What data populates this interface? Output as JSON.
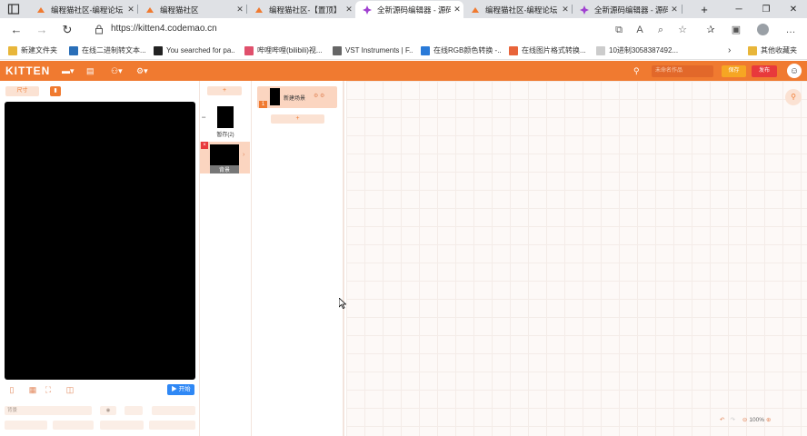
{
  "browser": {
    "tabs": [
      {
        "title": "编程猫社区-编程论坛",
        "favicon_color": "#f07a30",
        "active": false
      },
      {
        "title": "编程猫社区",
        "favicon_color": "#f07a30",
        "active": false
      },
      {
        "title": "编程猫社区-【置顶】",
        "favicon_color": "#f07a30",
        "active": false
      },
      {
        "title": "全新源码编辑器 - 源码",
        "favicon_color": "#a040d0",
        "active": true
      },
      {
        "title": "编程猫社区-编程论坛",
        "favicon_color": "#f07a30",
        "active": false
      },
      {
        "title": "全新源码编辑器 - 源码",
        "favicon_color": "#a040d0",
        "active": false
      }
    ],
    "url": "https://kitten4.codemao.cn",
    "bookmarks": [
      {
        "label": "新建文件夹",
        "icon_color": "#e8b63a"
      },
      {
        "label": "在线二进制转文本...",
        "icon_color": "#2a6fb8"
      },
      {
        "label": "You searched for pa...",
        "icon_color": "#222222"
      },
      {
        "label": "哔哩哔哩(bilibili)视...",
        "icon_color": "#e0506c"
      },
      {
        "label": "VST Instruments | F...",
        "icon_color": "#666666"
      },
      {
        "label": "在线RGB颜色转换 -...",
        "icon_color": "#2a7ad8"
      },
      {
        "label": "在线图片格式转换...",
        "icon_color": "#e8643a"
      },
      {
        "label": "10进制3058387492...",
        "icon_color": "#cccccc"
      }
    ],
    "other_bookmarks": "其他收藏夹"
  },
  "kitten": {
    "logo": "KITTEN",
    "project_name_placeholder": "未命名作品",
    "save_label": "保存",
    "publish_label": "发布"
  },
  "stage": {
    "width_label": "尺寸",
    "start_label": "开始",
    "prop_background": "背景"
  },
  "sprites": {
    "add_label": "+",
    "items": [
      {
        "label": "暂存(2)"
      },
      {
        "label": "背景"
      }
    ]
  },
  "scenes": {
    "item_label": "新建场景",
    "add_label": "+"
  },
  "workspace": {
    "zoom": "100%"
  },
  "colors": {
    "brand": "#f07a30",
    "save": "#f6a623",
    "publish": "#e8393c",
    "start": "#2f88f5"
  }
}
